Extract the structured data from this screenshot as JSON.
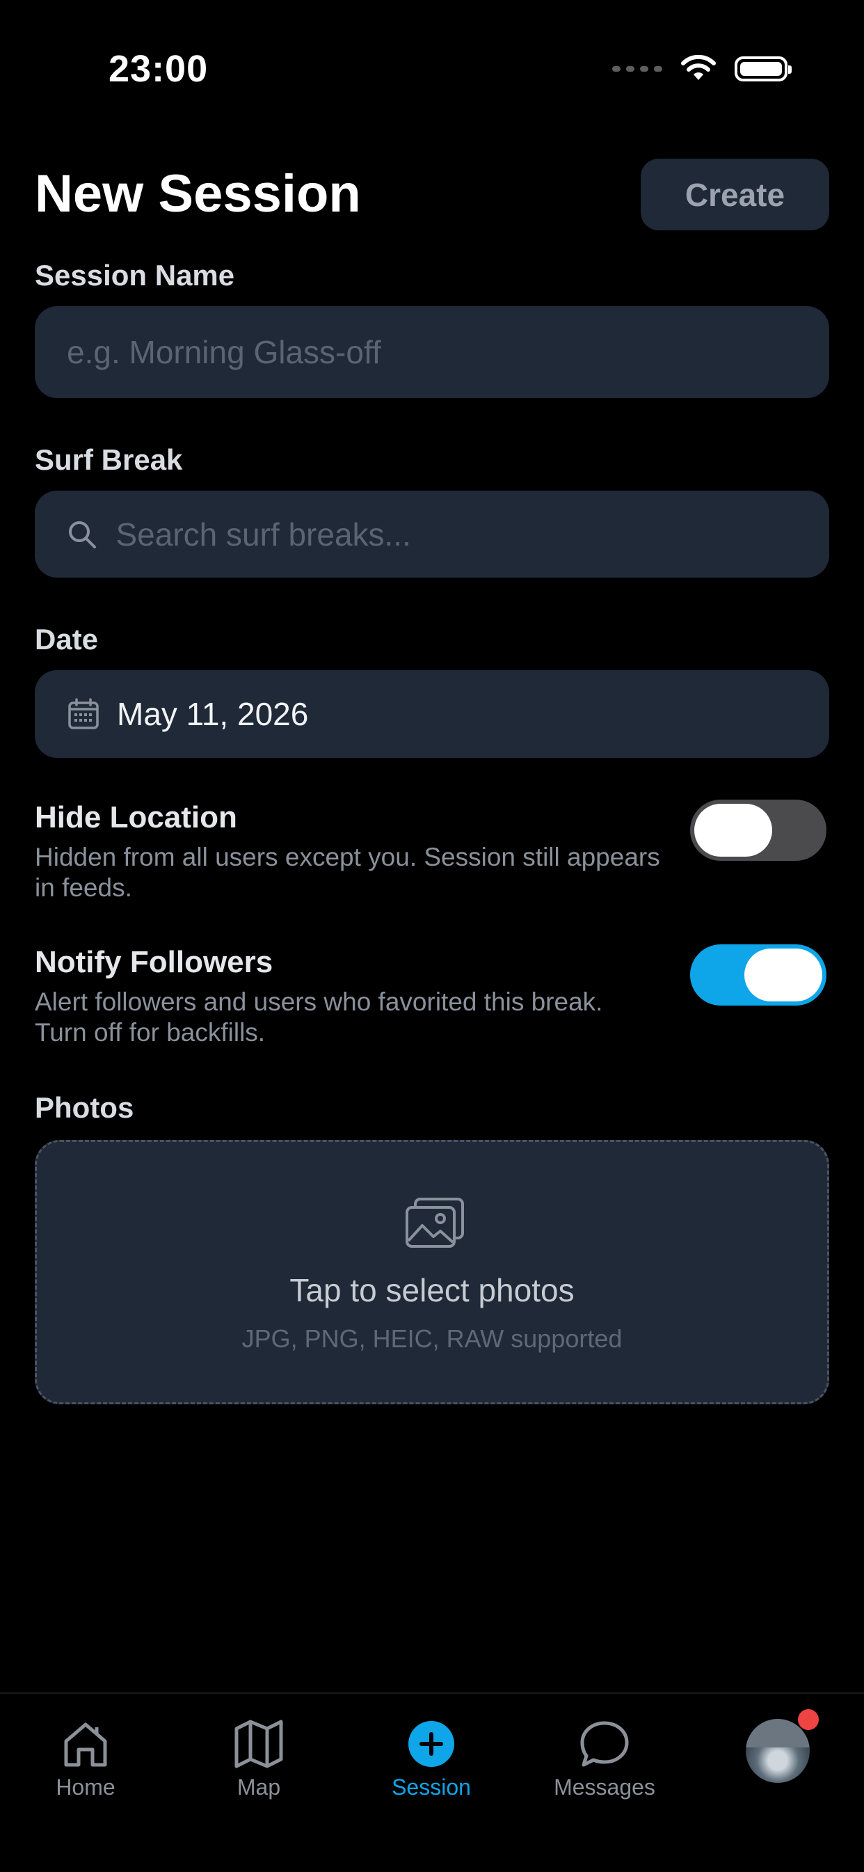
{
  "status_bar": {
    "time": "23:00"
  },
  "header": {
    "title": "New Session",
    "create_label": "Create"
  },
  "form": {
    "session_name": {
      "label": "Session Name",
      "placeholder": "e.g. Morning Glass-off",
      "value": ""
    },
    "surf_break": {
      "label": "Surf Break",
      "placeholder": "Search surf breaks...",
      "icon": "search-icon"
    },
    "date": {
      "label": "Date",
      "value": "May 11, 2026",
      "icon": "calendar-icon"
    },
    "hide_location": {
      "title": "Hide Location",
      "description": "Hidden from all users except you. Session still appears in feeds.",
      "enabled": false
    },
    "notify_followers": {
      "title": "Notify Followers",
      "description": "Alert followers and users who favorited this break. Turn off for backfills.",
      "enabled": true
    },
    "photos": {
      "label": "Photos",
      "prompt": "Tap to select photos",
      "formats": "JPG, PNG, HEIC, RAW supported",
      "icon": "image-icon"
    }
  },
  "tabbar": {
    "items": [
      {
        "label": "Home",
        "icon": "home-icon",
        "active": false
      },
      {
        "label": "Map",
        "icon": "map-icon",
        "active": false
      },
      {
        "label": "Session",
        "icon": "plus-circle-icon",
        "active": true
      },
      {
        "label": "Messages",
        "icon": "chat-bubble-icon",
        "active": false
      }
    ],
    "profile_has_notification": true
  },
  "colors": {
    "background": "#000000",
    "field_bg": "#1f2937",
    "accent": "#0ea5e9",
    "toggle_off": "#4b4b4d",
    "badge": "#ef4444"
  }
}
